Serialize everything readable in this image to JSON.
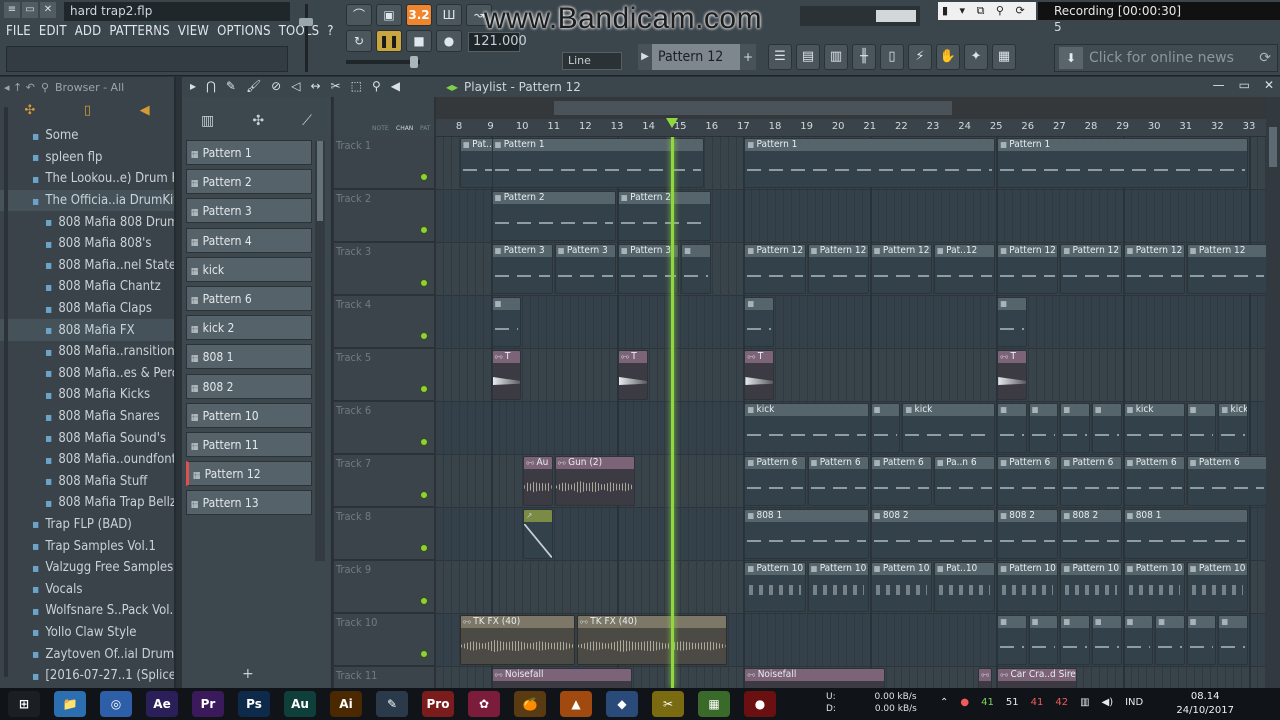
{
  "window": {
    "title": "hard trap2.flp",
    "recording": "Recording [00:00:30]",
    "watermark": "www.Bandicam.com"
  },
  "menu": [
    "FILE",
    "EDIT",
    "ADD",
    "PATTERNS",
    "VIEW",
    "OPTIONS",
    "TOOLS",
    "?"
  ],
  "transport": {
    "tempo": "121.000",
    "snap": "Line",
    "pattern": "Pattern 12",
    "meter_value": "5"
  },
  "news": {
    "label": "Click for online news"
  },
  "browser": {
    "header": "Browser - All",
    "items": [
      {
        "label": "Some",
        "level": 1
      },
      {
        "label": "spleen flp",
        "level": 1
      },
      {
        "label": "The Lookou..e) Drum Kit",
        "level": 1
      },
      {
        "label": "The Officia..ia DrumKit",
        "level": 1,
        "selected": true
      },
      {
        "label": "808 Mafia 808 Drums",
        "level": 2
      },
      {
        "label": "808 Mafia 808's",
        "level": 2
      },
      {
        "label": "808 Mafia..nel States",
        "level": 2
      },
      {
        "label": "808 Mafia Chantz",
        "level": 2
      },
      {
        "label": "808 Mafia Claps",
        "level": 2
      },
      {
        "label": "808 Mafia FX",
        "level": 2,
        "selected": true
      },
      {
        "label": "808 Mafia..ransitions",
        "level": 2
      },
      {
        "label": "808 Mafia..es & Percs",
        "level": 2
      },
      {
        "label": "808 Mafia Kicks",
        "level": 2
      },
      {
        "label": "808 Mafia Snares",
        "level": 2
      },
      {
        "label": "808 Mafia Sound's",
        "level": 2
      },
      {
        "label": "808 Mafia..oundfonts",
        "level": 2
      },
      {
        "label": "808 Mafia Stuff",
        "level": 2
      },
      {
        "label": "808 Mafia Trap Bellz",
        "level": 2
      },
      {
        "label": "Trap FLP (BAD)",
        "level": 1
      },
      {
        "label": "Trap Samples Vol.1",
        "level": 1
      },
      {
        "label": "Valzugg Free Samples",
        "level": 1
      },
      {
        "label": "Vocals",
        "level": 1
      },
      {
        "label": "Wolfsnare S..Pack Vol.1",
        "level": 1
      },
      {
        "label": "Yollo Claw Style",
        "level": 1
      },
      {
        "label": "Zaytoven Of..ial Drumkit",
        "level": 1
      },
      {
        "label": "[2016-07-27..1 (Splice)",
        "level": 1
      }
    ]
  },
  "playlist": {
    "title": "Playlist - Pattern 12",
    "column_labels": [
      "NOTE",
      "CHAN",
      "PAT"
    ],
    "ruler": [
      "8",
      "9",
      "10",
      "11",
      "12",
      "13",
      "14",
      "15",
      "16",
      "17",
      "18",
      "19",
      "20",
      "21",
      "22",
      "23",
      "24",
      "25",
      "26",
      "27",
      "28",
      "29",
      "30",
      "31",
      "32",
      "33"
    ],
    "patterns": [
      "Pattern 1",
      "Pattern 2",
      "Pattern 3",
      "Pattern 4",
      "kick",
      "Pattern 6",
      "kick 2",
      "808 1",
      "808 2",
      "Pattern 10",
      "Pattern 11",
      "Pattern 12",
      "Pattern 13"
    ],
    "active_pattern": "Pattern 12",
    "tracks": [
      "Track 1",
      "Track 2",
      "Track 3",
      "Track 4",
      "Track 5",
      "Track 6",
      "Track 7",
      "Track 8",
      "Track 9",
      "Track 10",
      "Track 11"
    ],
    "clips": [
      {
        "track": 0,
        "bar": 8,
        "len": 1.7,
        "label": "Pat..n 1"
      },
      {
        "track": 0,
        "bar": 9,
        "len": 6.8,
        "label": "Pattern 1"
      },
      {
        "track": 0,
        "bar": 17,
        "len": 8,
        "label": "Pattern 1"
      },
      {
        "track": 0,
        "bar": 25,
        "len": 8,
        "label": "Pattern 1"
      },
      {
        "track": 1,
        "bar": 9,
        "len": 4,
        "label": "Pattern 2"
      },
      {
        "track": 1,
        "bar": 13,
        "len": 3,
        "label": "Pattern 2"
      },
      {
        "track": 2,
        "bar": 9,
        "len": 2,
        "label": "Pattern 3"
      },
      {
        "track": 2,
        "bar": 11,
        "len": 2,
        "label": "Pattern 3"
      },
      {
        "track": 2,
        "bar": 13,
        "len": 2,
        "label": "Pattern 3"
      },
      {
        "track": 2,
        "bar": 15,
        "len": 1,
        "label": ""
      },
      {
        "track": 2,
        "bar": 17,
        "len": 2,
        "label": "Pattern 12"
      },
      {
        "track": 2,
        "bar": 19,
        "len": 2,
        "label": "Pattern 12"
      },
      {
        "track": 2,
        "bar": 21,
        "len": 2,
        "label": "Pattern 12"
      },
      {
        "track": 2,
        "bar": 23,
        "len": 2,
        "label": "Pat..12"
      },
      {
        "track": 2,
        "bar": 25,
        "len": 2,
        "label": "Pattern 12"
      },
      {
        "track": 2,
        "bar": 27,
        "len": 2,
        "label": "Pattern 12"
      },
      {
        "track": 2,
        "bar": 29,
        "len": 2,
        "label": "Pattern 12"
      },
      {
        "track": 2,
        "bar": 31,
        "len": 2.6,
        "label": "Pattern 12"
      },
      {
        "track": 3,
        "bar": 9,
        "len": 1,
        "label": ""
      },
      {
        "track": 3,
        "bar": 17,
        "len": 1,
        "label": ""
      },
      {
        "track": 3,
        "bar": 25,
        "len": 1,
        "label": ""
      },
      {
        "track": 4,
        "bar": 9,
        "len": 1,
        "label": "T",
        "kind": "fx"
      },
      {
        "track": 4,
        "bar": 13,
        "len": 1,
        "label": "T",
        "kind": "fx"
      },
      {
        "track": 4,
        "bar": 17,
        "len": 1,
        "label": "T",
        "kind": "fx"
      },
      {
        "track": 4,
        "bar": 25,
        "len": 1,
        "label": "T",
        "kind": "fx"
      },
      {
        "track": 5,
        "bar": 17,
        "len": 4,
        "label": "kick"
      },
      {
        "track": 5,
        "bar": 21,
        "len": 1,
        "label": ""
      },
      {
        "track": 5,
        "bar": 22,
        "len": 3,
        "label": "kick"
      },
      {
        "track": 5,
        "bar": 25,
        "len": 1,
        "label": ""
      },
      {
        "track": 5,
        "bar": 26,
        "len": 1,
        "label": ""
      },
      {
        "track": 5,
        "bar": 27,
        "len": 1,
        "label": ""
      },
      {
        "track": 5,
        "bar": 28,
        "len": 1,
        "label": ""
      },
      {
        "track": 5,
        "bar": 29,
        "len": 2,
        "label": "kick"
      },
      {
        "track": 5,
        "bar": 31,
        "len": 1,
        "label": ""
      },
      {
        "track": 5,
        "bar": 32,
        "len": 1,
        "label": "kick"
      },
      {
        "track": 6,
        "bar": 10,
        "len": 1,
        "label": "Au",
        "kind": "fx"
      },
      {
        "track": 6,
        "bar": 11,
        "len": 2.6,
        "label": "Gun (2)",
        "kind": "fx"
      },
      {
        "track": 6,
        "bar": 17,
        "len": 2,
        "label": "Pattern 6"
      },
      {
        "track": 6,
        "bar": 19,
        "len": 2,
        "label": "Pattern 6"
      },
      {
        "track": 6,
        "bar": 21,
        "len": 2,
        "label": "Pattern 6"
      },
      {
        "track": 6,
        "bar": 23,
        "len": 2,
        "label": "Pa..n 6"
      },
      {
        "track": 6,
        "bar": 25,
        "len": 2,
        "label": "Pattern 6"
      },
      {
        "track": 6,
        "bar": 27,
        "len": 2,
        "label": "Pattern 6"
      },
      {
        "track": 6,
        "bar": 29,
        "len": 2,
        "label": "Pattern 6"
      },
      {
        "track": 6,
        "bar": 31,
        "len": 2.6,
        "label": "Pattern 6"
      },
      {
        "track": 7,
        "bar": 10,
        "len": 1,
        "label": "",
        "kind": "auto"
      },
      {
        "track": 7,
        "bar": 17,
        "len": 4,
        "label": "808 1"
      },
      {
        "track": 7,
        "bar": 21,
        "len": 4,
        "label": "808 2"
      },
      {
        "track": 7,
        "bar": 25,
        "len": 2,
        "label": "808 2"
      },
      {
        "track": 7,
        "bar": 27,
        "len": 2,
        "label": "808 2"
      },
      {
        "track": 7,
        "bar": 29,
        "len": 4,
        "label": "808 1"
      },
      {
        "track": 8,
        "bar": 17,
        "len": 2,
        "label": "Pattern 10"
      },
      {
        "track": 8,
        "bar": 19,
        "len": 2,
        "label": "Pattern 10"
      },
      {
        "track": 8,
        "bar": 21,
        "len": 2,
        "label": "Pattern 10"
      },
      {
        "track": 8,
        "bar": 23,
        "len": 2,
        "label": "Pat..10"
      },
      {
        "track": 8,
        "bar": 25,
        "len": 2,
        "label": "Pattern 10"
      },
      {
        "track": 8,
        "bar": 27,
        "len": 2,
        "label": "Pattern 10"
      },
      {
        "track": 8,
        "bar": 29,
        "len": 2,
        "label": "Pattern 10"
      },
      {
        "track": 8,
        "bar": 31,
        "len": 2,
        "label": "Pattern 10"
      },
      {
        "track": 9,
        "bar": 8,
        "len": 3.7,
        "label": "TK FX (40)",
        "kind": "audio"
      },
      {
        "track": 9,
        "bar": 11.7,
        "len": 4.8,
        "label": "TK FX (40)",
        "kind": "audio"
      },
      {
        "track": 9,
        "bar": 25,
        "len": 1,
        "label": ""
      },
      {
        "track": 9,
        "bar": 26,
        "len": 1,
        "label": ""
      },
      {
        "track": 9,
        "bar": 27,
        "len": 1,
        "label": ""
      },
      {
        "track": 9,
        "bar": 28,
        "len": 1,
        "label": ""
      },
      {
        "track": 9,
        "bar": 29,
        "len": 1,
        "label": ""
      },
      {
        "track": 9,
        "bar": 30,
        "len": 1,
        "label": ""
      },
      {
        "track": 9,
        "bar": 31,
        "len": 1,
        "label": ""
      },
      {
        "track": 9,
        "bar": 32,
        "len": 1,
        "label": ""
      },
      {
        "track": 10,
        "bar": 9,
        "len": 4.5,
        "label": "Noisefall",
        "kind": "fx"
      },
      {
        "track": 10,
        "bar": 17,
        "len": 4.5,
        "label": "Noisefall",
        "kind": "fx"
      },
      {
        "track": 10,
        "bar": 24.4,
        "len": 0.5,
        "label": "",
        "kind": "fx"
      },
      {
        "track": 10,
        "bar": 25,
        "len": 2.6,
        "label": "Car Cra..d Siren",
        "kind": "fx"
      }
    ],
    "playhead_bar": 14.7
  },
  "taskbar": {
    "apps": [
      {
        "label": "⊞",
        "color": "#1a1f24"
      },
      {
        "label": "📁",
        "color": "#2c6fb0"
      },
      {
        "label": "◎",
        "color": "#2d5fa8"
      },
      {
        "label": "Ae",
        "color": "#2b1f5a"
      },
      {
        "label": "Pr",
        "color": "#3a1a5a"
      },
      {
        "label": "Ps",
        "color": "#0e2a4a"
      },
      {
        "label": "Au",
        "color": "#0f3f3a"
      },
      {
        "label": "Ai",
        "color": "#4a2800"
      },
      {
        "label": "✎",
        "color": "#2a3a4a"
      },
      {
        "label": "Pro",
        "color": "#7a1c1c"
      },
      {
        "label": "✿",
        "color": "#7a1c3a"
      },
      {
        "label": "🍊",
        "color": "#5a3a10"
      },
      {
        "label": "▲",
        "color": "#a04a10"
      },
      {
        "label": "◆",
        "color": "#2a4a7a"
      },
      {
        "label": "✂",
        "color": "#7a6a10"
      },
      {
        "label": "▦",
        "color": "#3a6a2a"
      },
      {
        "label": "●",
        "color": "#6a1010"
      }
    ],
    "net_up": "0.00 kB/s",
    "net_down": "0.00 kB/s",
    "net_up_label": "U:",
    "net_down_label": "D:",
    "tray": [
      "41",
      "51",
      "41",
      "42",
      "IND"
    ],
    "time": "08.14",
    "date": "24/10/2017"
  }
}
